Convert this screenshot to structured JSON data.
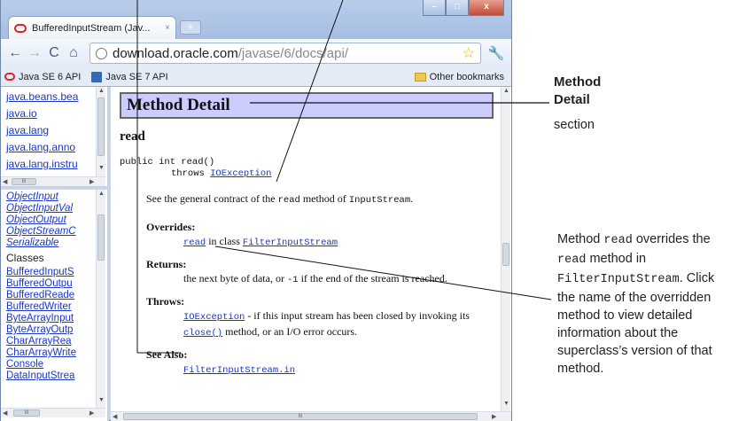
{
  "browser": {
    "tab_title": "BufferedInputStream (Jav...",
    "tab_close": "×",
    "new_tab": "+",
    "window_controls": {
      "minimize": "–",
      "maximize": "□",
      "close": "x"
    },
    "nav": {
      "back": "←",
      "forward": "→",
      "reload": "C",
      "home": "⌂"
    },
    "url_host": "download.oracle.com",
    "url_path": "/javase/6/docs/api/",
    "star": "☆",
    "wrench": "🔧",
    "bookmarks": [
      "Java SE 6 API",
      "Java SE 7 API"
    ],
    "other_bookmarks": "Other bookmarks"
  },
  "package_frame": {
    "items": [
      "java.beans.bea",
      "java.io",
      "java.lang",
      "java.lang.anno",
      "java.lang.instru"
    ],
    "hscroll_label": "III"
  },
  "class_frame": {
    "interfaces": [
      "ObjectInput",
      "ObjectInputVal",
      "ObjectOutput",
      "ObjectStreamC",
      "Serializable"
    ],
    "heading": "Classes",
    "classes": [
      "BufferedInputS",
      "BufferedOutpu",
      "BufferedReade",
      "BufferedWriter",
      "ByteArrayInput",
      "ByteArrayOutp",
      "CharArrayRea",
      "CharArrayWrite",
      "Console",
      "DataInputStrea"
    ],
    "hscroll_label": "III"
  },
  "main_frame": {
    "section_title": "Method Detail",
    "method_name": "read",
    "signature_line1": "public int read()",
    "throws_word": "throws",
    "throws_link": "IOException",
    "description_pre": "See the general contract of the",
    "description_code": "read",
    "description_mid": "method of",
    "description_code2": "InputStream",
    "description_post": ".",
    "overrides_label": "Overrides:",
    "overrides_link": "read",
    "overrides_mid": "in class",
    "overrides_class": "FilterInputStream",
    "returns_label": "Returns:",
    "returns_text1": "the next byte of data, or",
    "returns_code": "-1",
    "returns_text2": "if the end of the stream is reached.",
    "throws_label": "Throws:",
    "throws_dd_link": "IOException",
    "throws_dd_text1": "- if this input stream has been closed by invoking its",
    "throws_dd_code": "close()",
    "throws_dd_text2": "method, or an I/O error occurs.",
    "see_also_label": "See Also:",
    "see_also_link": "FilterInputStream.in",
    "hscroll_label": "III"
  },
  "annotations": {
    "title_line1": "Method",
    "title_line2": "Detail",
    "subtitle": "section",
    "right_1": "Method",
    "right_code1": "read",
    "right_2": "overrides",
    "right_3": "the",
    "right_code2": "read",
    "right_4": "method in",
    "right_code3": "FilterInputStream",
    "right_5": ".",
    "right_6": "Click the name of the overridden method to view detailed information about the superclass’s version of that method."
  },
  "colors": {
    "detail_bg": "#ccccff",
    "link": "#1a36c8",
    "callout_line": "#111111"
  }
}
